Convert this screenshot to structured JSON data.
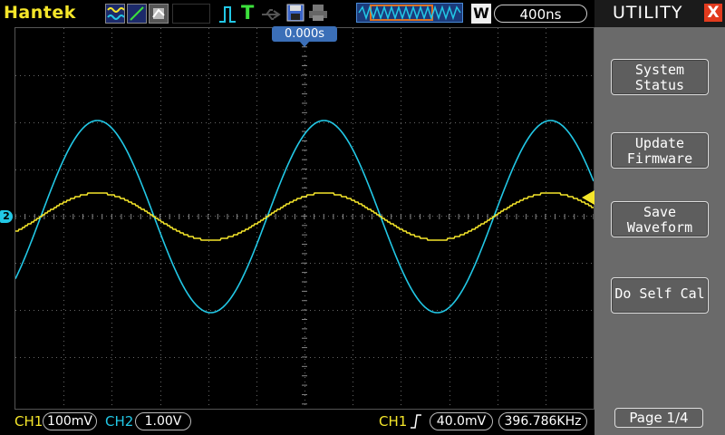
{
  "brand": "Hantek",
  "top": {
    "timebase": "400ns",
    "window_mode": "W",
    "trigger_position": "0.000s"
  },
  "side": {
    "title": "UTILITY",
    "close": "X",
    "buttons": [
      "System\nStatus",
      "Update\nFirmware",
      "Save\nWaveform",
      "Do Self Cal"
    ],
    "page": "Page 1/4"
  },
  "bottom": {
    "ch1_label": "CH1",
    "ch1_scale": "100mV",
    "ch2_label": "CH2",
    "ch2_scale": "1.00V",
    "trig_label": "CH1",
    "trig_level": "40.0mV",
    "frequency": "396.786KHz"
  },
  "markers": {
    "ch2": "2"
  },
  "colors": {
    "ch1": "#f5e62a",
    "ch2": "#22c8e6",
    "accent": "#3b6fb8",
    "close": "#e23b1e"
  }
}
